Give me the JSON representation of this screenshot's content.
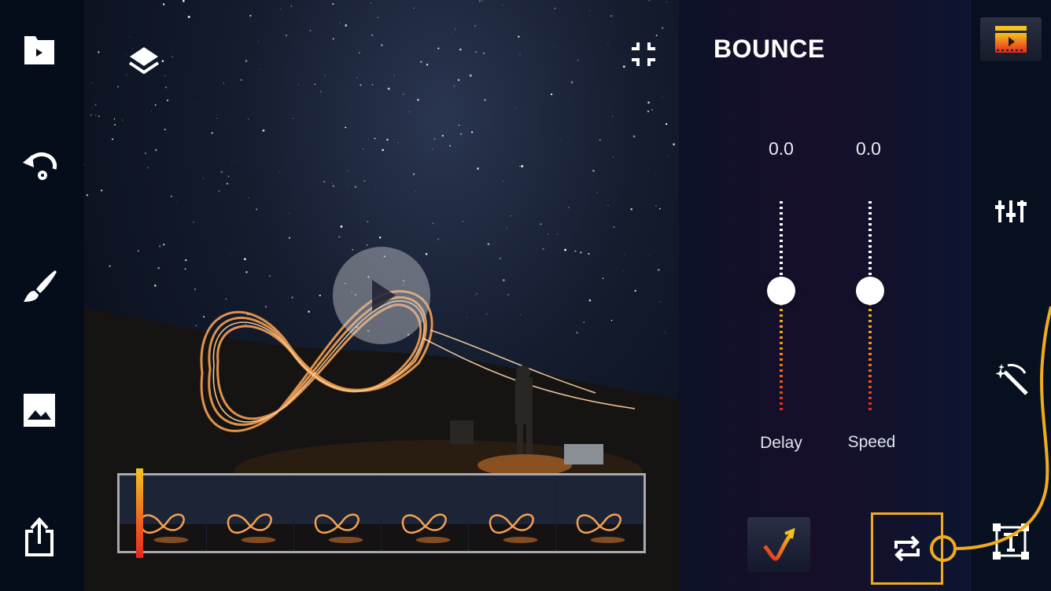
{
  "left_toolbar": {
    "items": [
      {
        "icon": "folder-play-icon"
      },
      {
        "icon": "undo-icon"
      },
      {
        "icon": "brush-icon"
      },
      {
        "icon": "image-icon"
      },
      {
        "icon": "share-icon"
      }
    ]
  },
  "preview": {
    "icons": {
      "layers": "layers-icon",
      "collapse": "collapse-icon",
      "play": "play-icon"
    }
  },
  "timeline": {
    "frame_count": 6,
    "playhead_colors": [
      "#f6c21f",
      "#f07a1c",
      "#e8271c"
    ]
  },
  "panel": {
    "title": "BOUNCE",
    "sliders": [
      {
        "label": "Delay",
        "value": "0.0",
        "level": 0.0
      },
      {
        "label": "Speed",
        "value": "0.0",
        "level": 0.0
      }
    ],
    "buttons": {
      "curve": "curve-arrow-icon",
      "loop": "loop-icon"
    }
  },
  "right_toolbar": {
    "items": [
      {
        "icon": "video-frame-icon"
      },
      {
        "icon": "adjust-sliders-icon"
      },
      {
        "icon": "magic-wand-icon"
      },
      {
        "icon": "text-box-icon"
      }
    ]
  },
  "colors": {
    "accent": "#f1ac1d",
    "gradient_start": "#f6c21f",
    "gradient_end": "#e8271c",
    "background": "#06101f"
  }
}
